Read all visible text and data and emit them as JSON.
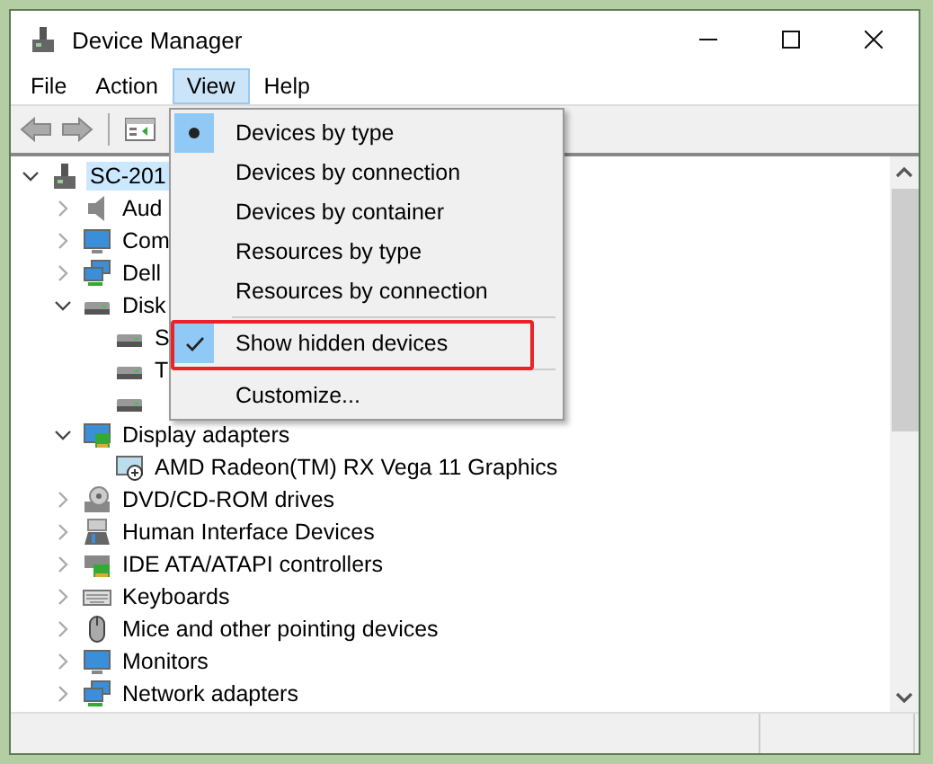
{
  "window": {
    "title": "Device Manager"
  },
  "menubar": [
    {
      "label": "File",
      "selected": false
    },
    {
      "label": "Action",
      "selected": false
    },
    {
      "label": "View",
      "selected": true
    },
    {
      "label": "Help",
      "selected": false
    }
  ],
  "view_menu": [
    {
      "kind": "radio",
      "label": "Devices by type",
      "selected": true
    },
    {
      "kind": "radio",
      "label": "Devices by connection",
      "selected": false
    },
    {
      "kind": "radio",
      "label": "Devices by container",
      "selected": false
    },
    {
      "kind": "radio",
      "label": "Resources by type",
      "selected": false
    },
    {
      "kind": "radio",
      "label": "Resources by connection",
      "selected": false
    },
    {
      "kind": "separator"
    },
    {
      "kind": "check",
      "label": "Show hidden devices",
      "checked": true,
      "highlighted": true
    },
    {
      "kind": "separator"
    },
    {
      "kind": "command",
      "label": "Customize..."
    }
  ],
  "tree": [
    {
      "label": "SC-201",
      "kind": "computer",
      "selected": true,
      "expanded": true,
      "children": [
        {
          "label": "Aud",
          "kind": "audio",
          "selected": false,
          "expanded": false
        },
        {
          "label": "Com",
          "kind": "monitor",
          "selected": false,
          "expanded": false
        },
        {
          "label": "Dell",
          "kind": "network",
          "selected": false,
          "expanded": false
        },
        {
          "label": "Disk",
          "kind": "disk",
          "selected": false,
          "expanded": true,
          "children": [
            {
              "label": "S",
              "kind": "disk"
            },
            {
              "label": "T",
              "kind": "disk"
            },
            {
              "kind": "disk"
            }
          ]
        },
        {
          "label": "Display adapters",
          "kind": "display",
          "selected": false,
          "expanded": true,
          "children": [
            {
              "label": "AMD Radeon(TM) RX Vega 11 Graphics",
              "kind": "display-device",
              "selected": false
            }
          ]
        },
        {
          "label": "DVD/CD-ROM drives",
          "kind": "dvd",
          "selected": false,
          "expanded": false
        },
        {
          "label": "Human Interface Devices",
          "kind": "hid",
          "selected": false,
          "expanded": false
        },
        {
          "label": "IDE ATA/ATAPI controllers",
          "kind": "ide",
          "selected": false,
          "expanded": false
        },
        {
          "label": "Keyboards",
          "kind": "keyboard",
          "selected": false,
          "expanded": false
        },
        {
          "label": "Mice and other pointing devices",
          "kind": "mouse",
          "selected": false,
          "expanded": false
        },
        {
          "label": "Monitors",
          "kind": "monitor",
          "selected": false,
          "expanded": false
        },
        {
          "label": "Network adapters",
          "kind": "network",
          "selected": false,
          "expanded": false
        }
      ]
    }
  ]
}
